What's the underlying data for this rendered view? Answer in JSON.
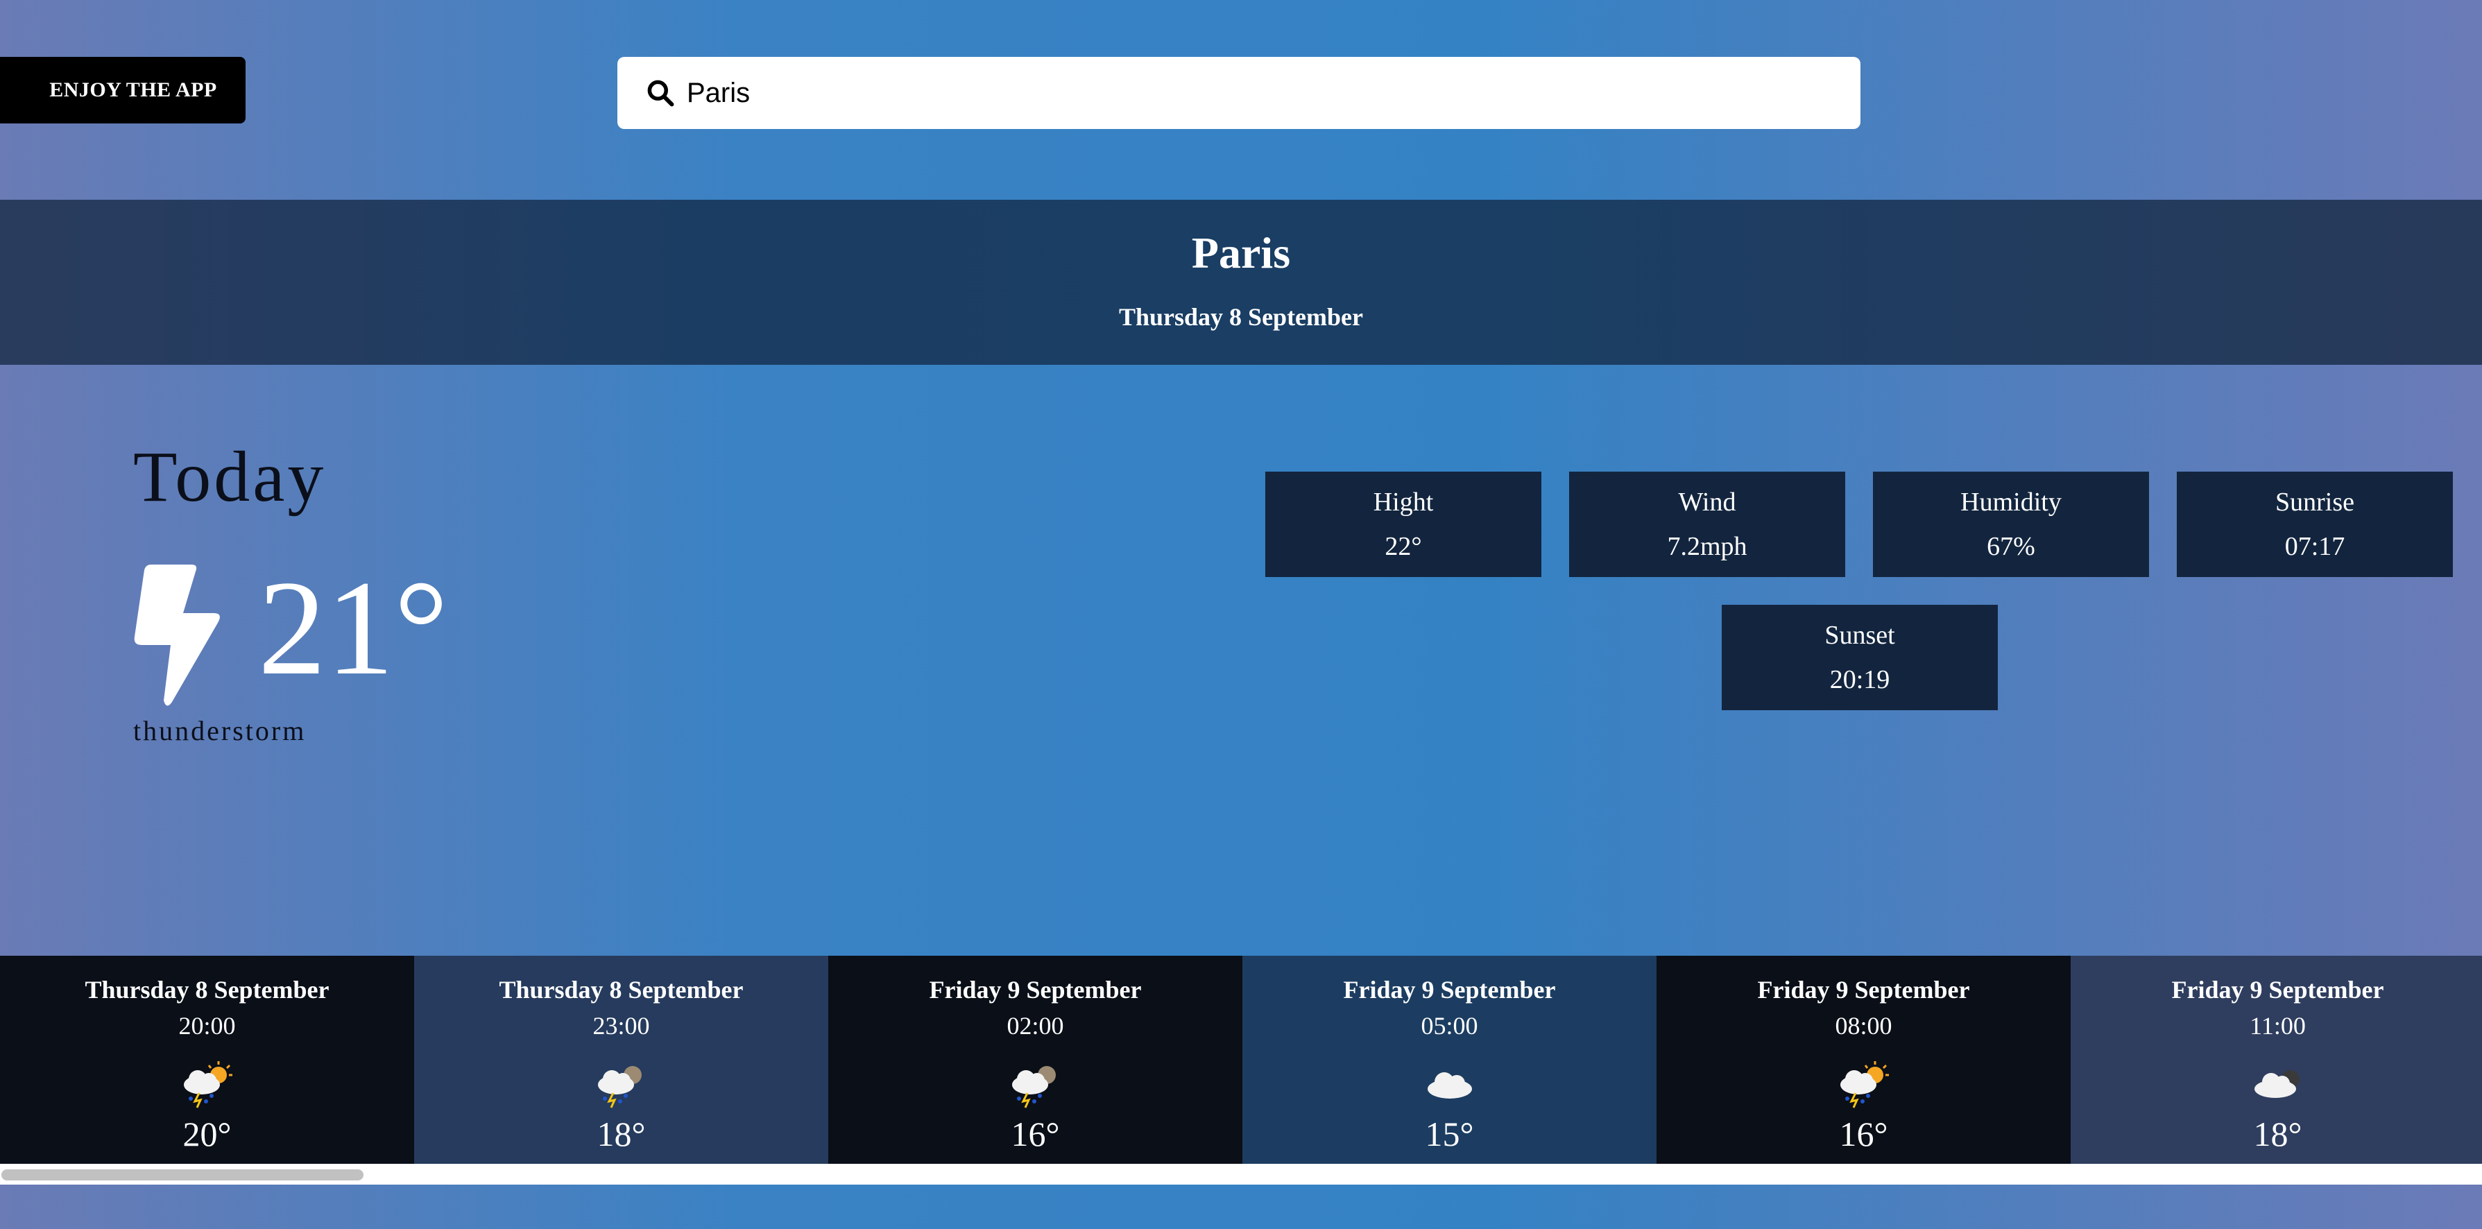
{
  "header": {
    "app_button_label": "ENJOY THE APP",
    "search": {
      "value": "Paris",
      "icon": "search-icon"
    }
  },
  "city": {
    "name": "Paris",
    "date": "Thursday 8 September"
  },
  "today": {
    "title": "Today",
    "icon": "lightning-bolt-icon",
    "temperature": "21°",
    "condition": "thunderstorm"
  },
  "stats": [
    {
      "label": "Hight",
      "value": "22°"
    },
    {
      "label": "Wind",
      "value": "7.2mph"
    },
    {
      "label": "Humidity",
      "value": "67%"
    },
    {
      "label": "Sunrise",
      "value": "07:17"
    },
    {
      "label": "Sunset",
      "value": "20:19"
    }
  ],
  "forecast": [
    {
      "date": "Thursday 8 September",
      "time": "20:00",
      "temp": "20°",
      "icon": "storm-sun-icon",
      "bg": "#0a0f18"
    },
    {
      "date": "Thursday 8 September",
      "time": "23:00",
      "temp": "18°",
      "icon": "storm-moon-icon",
      "bg": "#263b5d"
    },
    {
      "date": "Friday 9 September",
      "time": "02:00",
      "temp": "16°",
      "icon": "storm-moon-icon",
      "bg": "#0a0f18"
    },
    {
      "date": "Friday 9 September",
      "time": "05:00",
      "temp": "15°",
      "icon": "cloud-icon",
      "bg": "#1c3d61"
    },
    {
      "date": "Friday 9 September",
      "time": "08:00",
      "temp": "16°",
      "icon": "storm-sun-icon",
      "bg": "#0a0f18"
    },
    {
      "date": "Friday 9 September",
      "time": "11:00",
      "temp": "18°",
      "icon": "cloud-moon-icon",
      "bg": "#2f3e5f"
    }
  ],
  "colors": {
    "banner": "#1b3d63",
    "stat_box": "#13253e",
    "app_button": "#000000"
  }
}
